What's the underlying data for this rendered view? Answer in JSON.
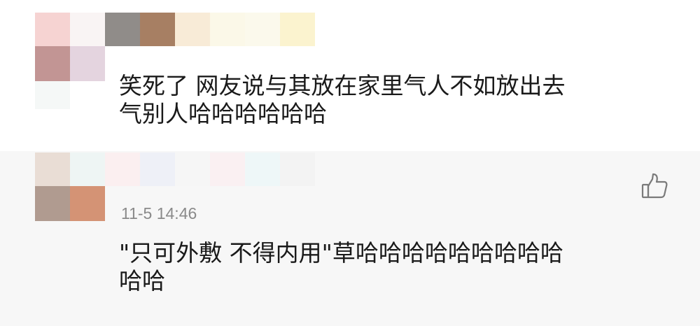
{
  "comments": [
    {
      "text": "笑死了 网友说与其放在家里气人不如放出去\n气别人哈哈哈哈哈哈"
    },
    {
      "timestamp": "11-5 14:46",
      "like_icon": "thumbs-up-icon",
      "text": "\"只可外敷 不得内用\"草哈哈哈哈哈哈哈哈哈\n哈哈"
    }
  ],
  "colors": {
    "text": "#1a1a1a",
    "timestamp": "#8a8a8a",
    "reply_background": "#f7f7f7",
    "icon_stroke": "#7a7a7a"
  }
}
